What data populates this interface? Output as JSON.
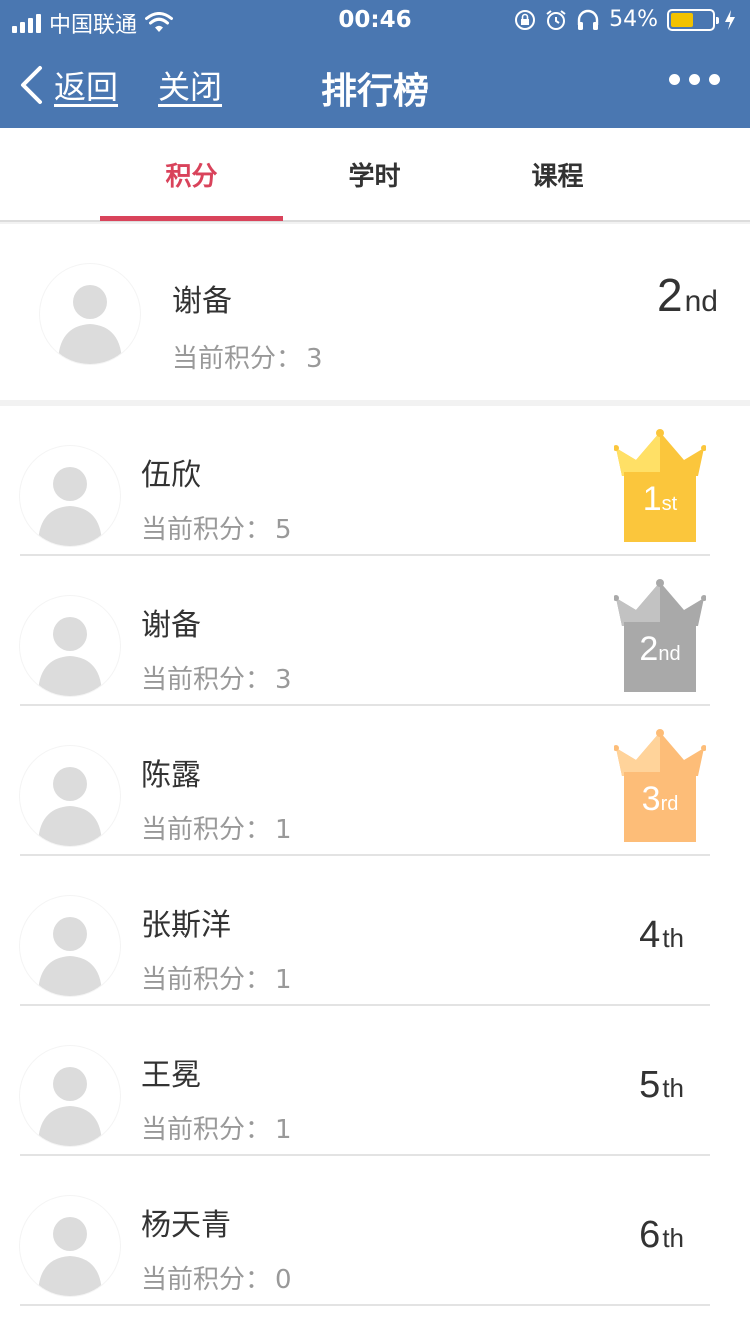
{
  "status_bar": {
    "carrier": "中国联通",
    "time": "00:46",
    "battery": "54%"
  },
  "nav": {
    "back_label": "返回",
    "close_label": "关闭",
    "title": "排行榜"
  },
  "tabs": [
    {
      "label": "积分",
      "active": true
    },
    {
      "label": "学时",
      "active": false
    },
    {
      "label": "课程",
      "active": false
    }
  ],
  "me": {
    "name": "谢备",
    "score_label": "当前积分：",
    "score": "3",
    "rank_num": "2",
    "rank_suffix": "nd"
  },
  "list": [
    {
      "name": "伍欣",
      "score_label": "当前积分：",
      "score": "5",
      "rank_num": "1",
      "rank_suffix": "st",
      "medal": "gold"
    },
    {
      "name": "谢备",
      "score_label": "当前积分：",
      "score": "3",
      "rank_num": "2",
      "rank_suffix": "nd",
      "medal": "silver"
    },
    {
      "name": "陈露",
      "score_label": "当前积分：",
      "score": "1",
      "rank_num": "3",
      "rank_suffix": "rd",
      "medal": "bronze"
    },
    {
      "name": "张斯洋",
      "score_label": "当前积分：",
      "score": "1",
      "rank_num": "4",
      "rank_suffix": "th",
      "medal": ""
    },
    {
      "name": "王冕",
      "score_label": "当前积分：",
      "score": "1",
      "rank_num": "5",
      "rank_suffix": "th",
      "medal": ""
    },
    {
      "name": "杨天青",
      "score_label": "当前积分：",
      "score": "0",
      "rank_num": "6",
      "rank_suffix": "th",
      "medal": ""
    }
  ],
  "colors": {
    "nav_bg": "#4a77b1",
    "tab_active": "#d9435b",
    "gold": "#fbc63c",
    "gold_light": "#ffe066",
    "silver": "#a9a9a9",
    "silver_light": "#c2c2c2",
    "bronze": "#fdbd78",
    "bronze_light": "#ffd39a"
  }
}
